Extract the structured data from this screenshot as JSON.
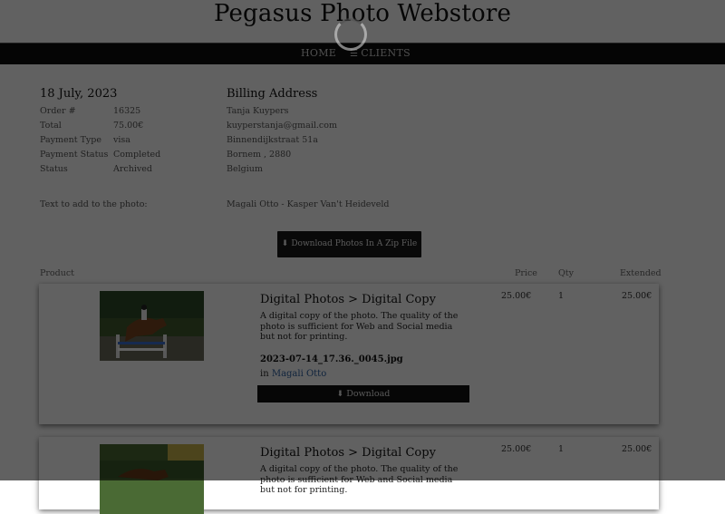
{
  "site": {
    "title": "Pegasus Photo Webstore"
  },
  "nav": {
    "home": "HOME",
    "clients": "CLIENTS"
  },
  "order": {
    "date": "18 July, 2023",
    "fields": [
      {
        "label": "Order #",
        "value": "16325"
      },
      {
        "label": "Total",
        "value": "75.00€"
      },
      {
        "label": "Payment Type",
        "value": "visa"
      },
      {
        "label": "Payment Status",
        "value": "Completed"
      },
      {
        "label": "Status",
        "value": "Archived"
      }
    ]
  },
  "billing": {
    "heading": "Billing Address",
    "name": "Tanja Kuypers",
    "email": "kuyperstanja@gmail.com",
    "street": "Binnendijkstraat 51a",
    "city": "Bornem , 2880",
    "country": "Belgium"
  },
  "photo_text": {
    "label": "Text to add to the photo:",
    "value": "Magali Otto - Kasper Van't Heideveld"
  },
  "zip_button": {
    "label": "Download Photos In A Zip File",
    "icon": "download-icon"
  },
  "table": {
    "headers": {
      "product": "Product",
      "price": "Price",
      "qty": "Qty",
      "extended": "Extended"
    }
  },
  "items": [
    {
      "title": "Digital Photos > Digital Copy",
      "description": "A digital copy of the photo. The quality of the photo is sufficient for Web and Social media but not for printing.",
      "file": "2023-07-14_17.36._0045.jpg",
      "in_label": "in",
      "client": "Magali Otto",
      "download_label": "Download",
      "price": "25.00€",
      "qty": "1",
      "extended": "25.00€"
    },
    {
      "title": "Digital Photos > Digital Copy",
      "description": "A digital copy of the photo. The quality of the photo is sufficient for Web and Social media but not for printing.",
      "price": "25.00€",
      "qty": "1",
      "extended": "25.00€"
    }
  ],
  "colors": {
    "link": "#2b5fa0",
    "nav_bg": "#0f0f0f",
    "overlay": "rgba(0,0,0,0.62)"
  }
}
